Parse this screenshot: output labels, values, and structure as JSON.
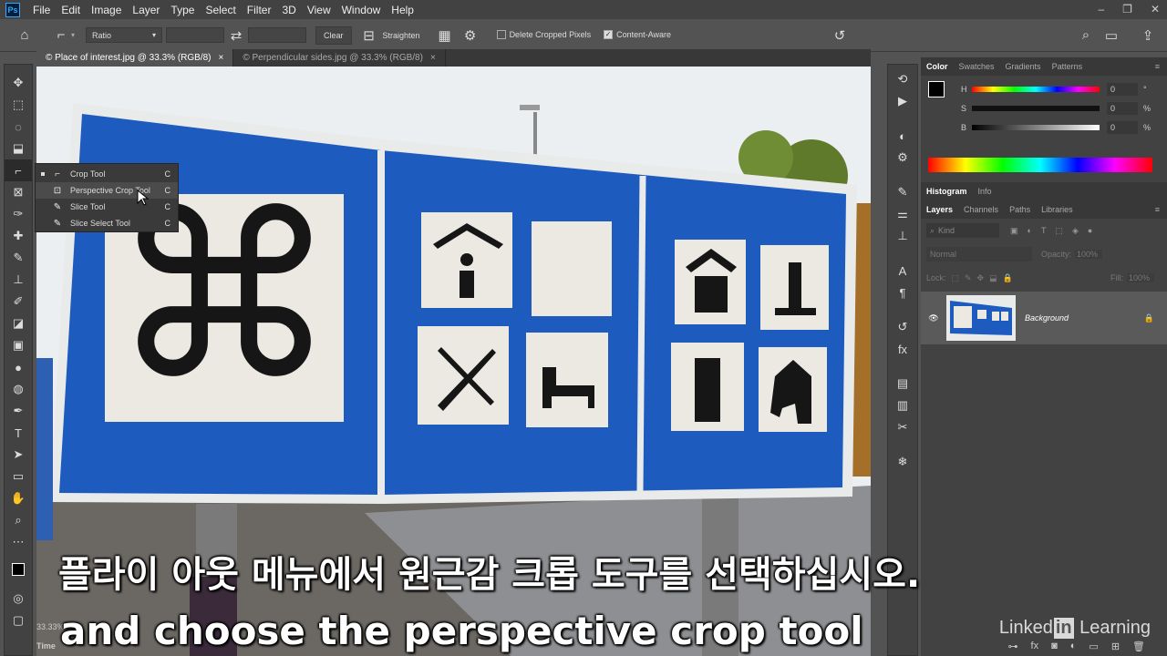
{
  "app": {
    "logo": "Ps"
  },
  "menu": [
    "File",
    "Edit",
    "Image",
    "Layer",
    "Type",
    "Select",
    "Filter",
    "3D",
    "View",
    "Window",
    "Help"
  ],
  "window_controls": [
    "–",
    "❐",
    "✕"
  ],
  "options": {
    "ratio_label": "Ratio",
    "clear_label": "Clear",
    "straighten_label": "Straighten",
    "delete_cropped_label": "Delete Cropped Pixels",
    "content_aware_label": "Content-Aware",
    "delete_cropped_checked": false,
    "content_aware_checked": true
  },
  "tabs": [
    {
      "label": "© Place of interest.jpg @ 33.3% (RGB/8)",
      "active": true
    },
    {
      "label": "© Perpendicular sides.jpg @ 33.3% (RGB/8)",
      "active": false
    }
  ],
  "flyout": {
    "items": [
      {
        "label": "Crop Tool",
        "key": "C",
        "icon": "crop-icon",
        "glyph": "⌐"
      },
      {
        "label": "Perspective Crop Tool",
        "key": "C",
        "icon": "perspective-crop-icon",
        "glyph": "⊡"
      },
      {
        "label": "Slice Tool",
        "key": "C",
        "icon": "slice-icon",
        "glyph": "✎"
      },
      {
        "label": "Slice Select Tool",
        "key": "C",
        "icon": "slice-select-icon",
        "glyph": "✎"
      }
    ]
  },
  "color_panel": {
    "tabs": [
      "Color",
      "Swatches",
      "Gradients",
      "Patterns"
    ],
    "channels": [
      {
        "name": "H",
        "value": "0",
        "unit": "°"
      },
      {
        "name": "S",
        "value": "0",
        "unit": "%"
      },
      {
        "name": "B",
        "value": "0",
        "unit": "%"
      }
    ]
  },
  "histogram_tabs": [
    "Histogram",
    "Info"
  ],
  "layers_panel": {
    "tabs": [
      "Layers",
      "Channels",
      "Paths",
      "Libraries"
    ],
    "kind_placeholder": "Kind",
    "blend_mode": "Normal",
    "opacity_label": "Opacity:",
    "opacity_value": "100%",
    "lock_label": "Lock:",
    "fill_label": "Fill:",
    "fill_value": "100%",
    "layers": [
      {
        "name": "Background",
        "visible": true,
        "locked": true
      }
    ]
  },
  "status": {
    "zoom": "33.33%",
    "footer": "Time"
  },
  "subtitles": {
    "korean": "플라이 아웃 메뉴에서 원근감 크롭 도구를 선택하십시오.",
    "english": "and choose the perspective crop tool"
  },
  "brand": {
    "part1": "Linked",
    "box": "in",
    "part2": " Learning"
  },
  "colors": {
    "sign_blue": "#1e5bbf",
    "ui_dark": "#424242",
    "accent": "#31a8ff"
  }
}
